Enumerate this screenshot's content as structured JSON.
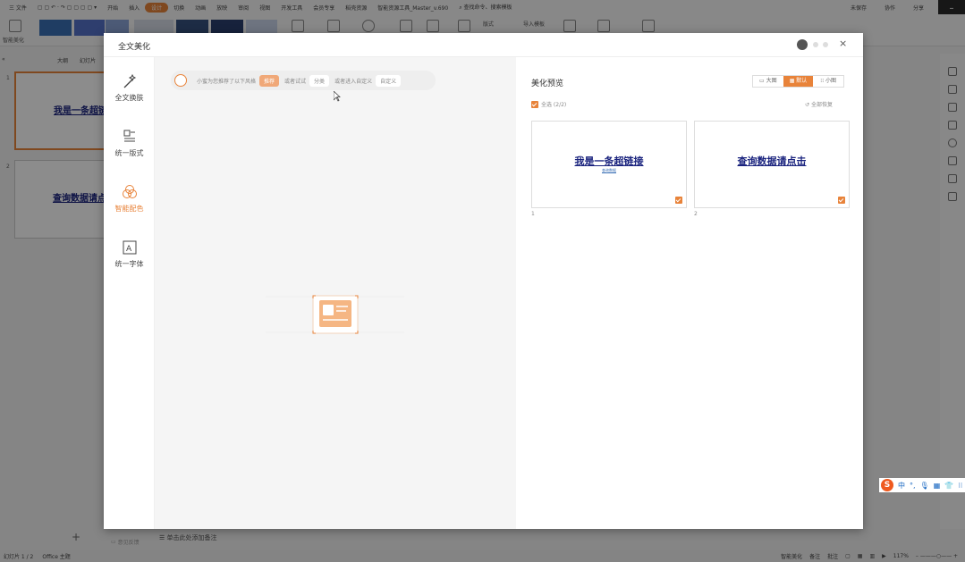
{
  "menubar": {
    "items": [
      "三 文件",
      "开始",
      "插入",
      "设计",
      "切换",
      "动画",
      "放映",
      "审阅",
      "视图",
      "开发工具",
      "会员专享",
      "稻壳资源",
      "智能资源工具_Master_v.690"
    ],
    "search": "查找命令、搜索模板",
    "right_items": [
      "未保存",
      "协作",
      "分享"
    ]
  },
  "ribbon": {
    "smart_beautify": "智能美化",
    "layout": "版式",
    "import_template": "导入模板"
  },
  "left_pane": {
    "tabs": [
      "大纲",
      "幻灯片"
    ],
    "slides": [
      {
        "num": "1",
        "title": "我是一条超链"
      },
      {
        "num": "2",
        "title": "查询数据请点"
      }
    ]
  },
  "notes_placeholder": "单击此处添加备注",
  "statusbar": {
    "slide_info": "幻灯片 1 / 2",
    "theme": "Office 主题",
    "smart_beautify": "智能美化",
    "notes": "备注",
    "comments": "批注",
    "zoom": "117%"
  },
  "modal": {
    "title": "全文美化",
    "sidebar": [
      {
        "label": "全文换肤",
        "icon": "magic-wand-icon"
      },
      {
        "label": "统一版式",
        "icon": "layout-icon"
      },
      {
        "label": "智能配色",
        "icon": "color-circles-icon"
      },
      {
        "label": "统一字体",
        "icon": "font-icon"
      }
    ],
    "feedback": "意见反馈",
    "tip": {
      "text": "小蜜为您推荐了以下风格",
      "recommend": "推荐",
      "or_try": "或者试试",
      "category": "分类",
      "or_enter": "或者进入自定义",
      "custom": "自定义"
    },
    "preview": {
      "title": "美化预览",
      "sizes": [
        "大图",
        "默认",
        "小图"
      ],
      "active_size": "默认",
      "select_all": "全选 (2/2)",
      "restore_all": "全部恢复",
      "cards": [
        {
          "num": "1",
          "title": "我是一条超链接",
          "sub": "查询数据"
        },
        {
          "num": "2",
          "title": "查询数据请点击",
          "sub": ""
        }
      ]
    }
  },
  "ime": {
    "label": "中"
  },
  "colors": {
    "accent": "#e8833a",
    "link": "#1a237e"
  }
}
